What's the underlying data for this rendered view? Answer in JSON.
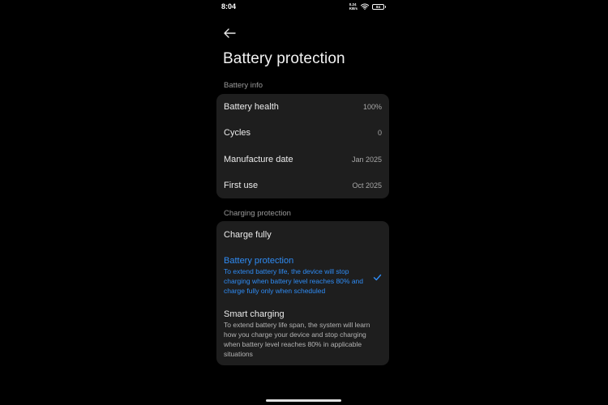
{
  "status_bar": {
    "time": "8:04",
    "net_speed_value": "0.24",
    "net_speed_unit": "KB/s",
    "battery_level": "84"
  },
  "header": {
    "title": "Battery protection"
  },
  "battery_info": {
    "section_label": "Battery info",
    "rows": [
      {
        "label": "Battery health",
        "value": "100%"
      },
      {
        "label": "Cycles",
        "value": "0"
      },
      {
        "label": "Manufacture date",
        "value": "Jan 2025"
      },
      {
        "label": "First use",
        "value": "Oct 2025"
      }
    ]
  },
  "charging_protection": {
    "section_label": "Charging protection",
    "options": [
      {
        "title": "Charge fully",
        "description": "",
        "selected": false
      },
      {
        "title": "Battery protection",
        "description": "To extend battery life, the device will stop charging when battery level reaches 80% and charge fully only when scheduled",
        "selected": true
      },
      {
        "title": "Smart charging",
        "description": "To extend battery life span, the system will learn how you charge your device and stop charging when battery level reaches 80% in applicable situations",
        "selected": false
      }
    ]
  },
  "colors": {
    "background": "#000000",
    "card": "#1e1e1e",
    "accent": "#2f8cf5",
    "text_primary": "#ececec",
    "text_secondary": "#9a9a9a"
  },
  "icons": {
    "back": "arrow-left-icon",
    "check": "check-icon",
    "wifi": "wifi-icon",
    "battery": "battery-icon"
  }
}
